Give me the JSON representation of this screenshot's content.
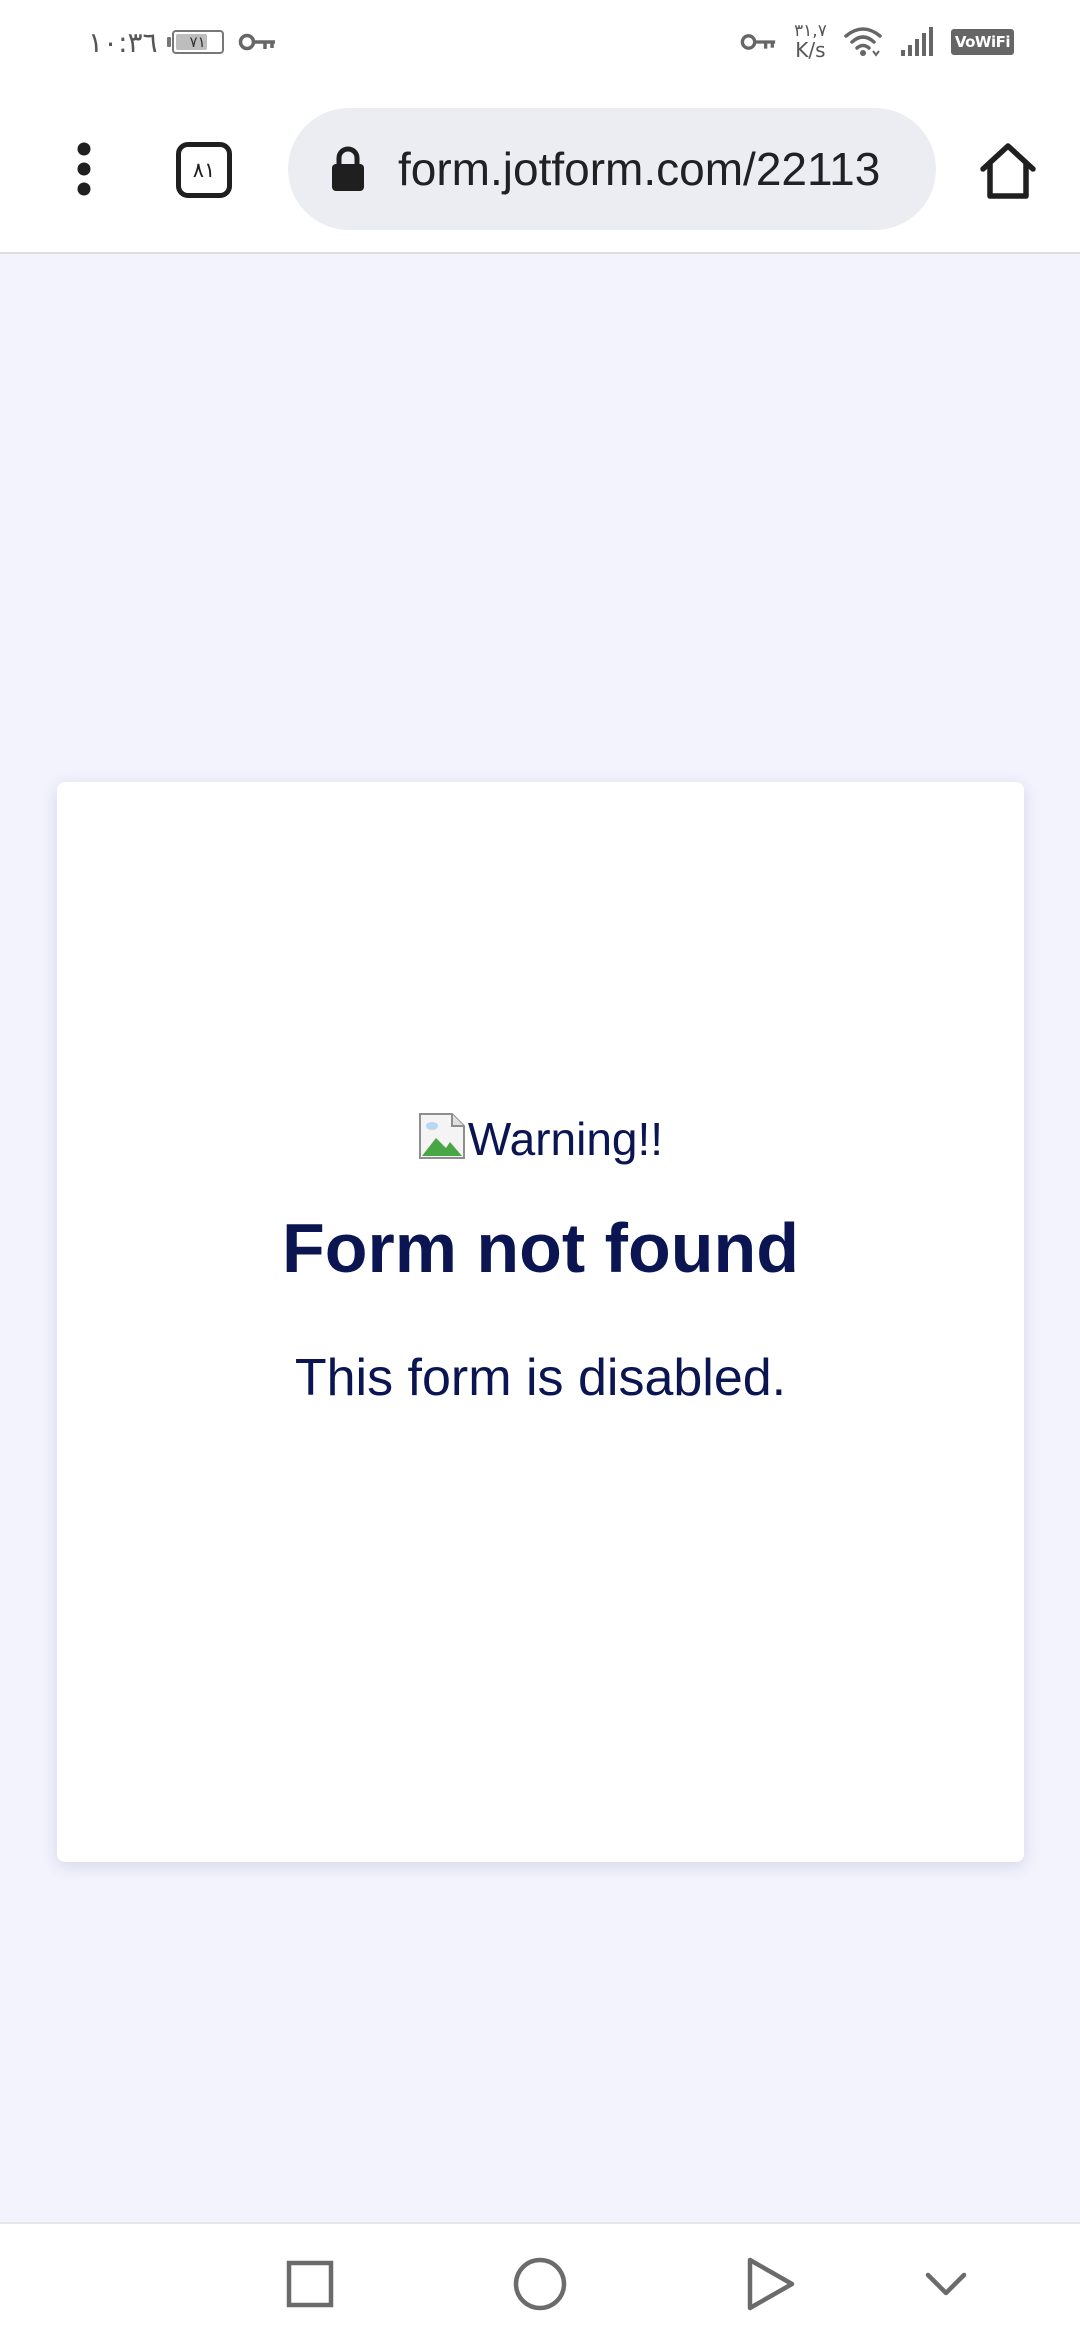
{
  "status_bar": {
    "time": "١٠:٣٦",
    "battery_level": "٧١",
    "battery_fraction": 0.71,
    "net_speed_value": "٣١,٧",
    "net_speed_unit": "K/s",
    "vowifi_label": "VoWiFi",
    "icons": [
      "key-icon",
      "wifi-icon",
      "signal-icon"
    ]
  },
  "browser": {
    "tab_count": "٨١",
    "url": "form.jotform.com/22113",
    "icons": {
      "menu": "more-vertical-icon",
      "lock": "lock-icon",
      "home": "home-icon"
    }
  },
  "page": {
    "background": "#f3f3fe",
    "text_color": "#0a1551",
    "image_alt": "Warning!!",
    "title": "Form not found",
    "message": "This form is disabled."
  },
  "nav_bar": {
    "buttons": [
      "recents",
      "home",
      "back",
      "hide-nav"
    ],
    "icons": [
      "square-icon",
      "circle-icon",
      "triangle-icon",
      "chevron-down-icon"
    ]
  }
}
